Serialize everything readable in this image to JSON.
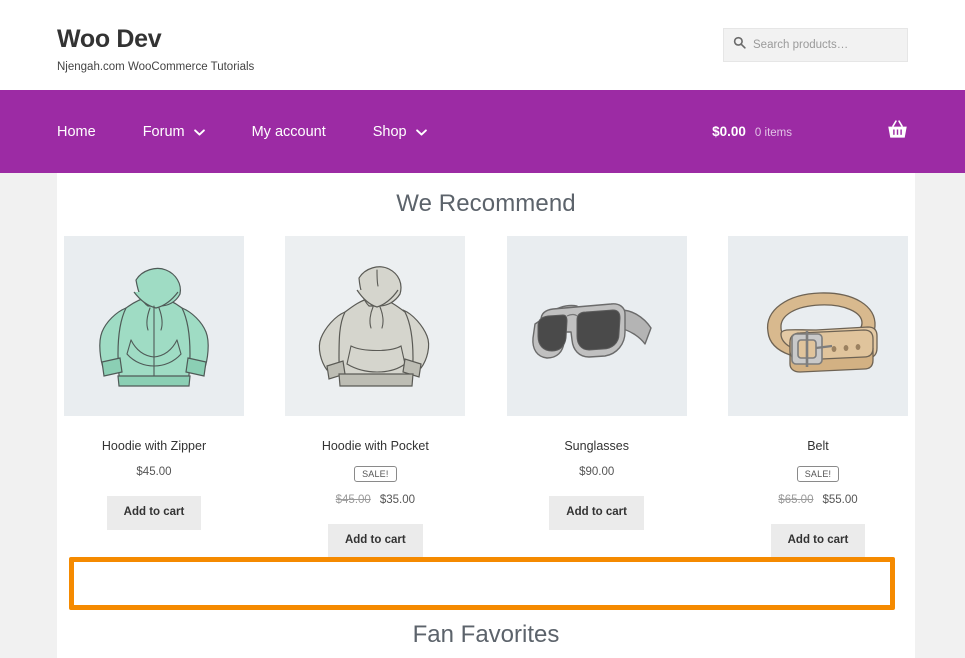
{
  "header": {
    "site_title": "Woo Dev",
    "tagline": "Njengah.com WooCommerce Tutorials",
    "search": {
      "placeholder": "Search products…",
      "value": "",
      "icon": "search-icon"
    }
  },
  "nav": {
    "background_color": "#9c2ba4",
    "items": [
      {
        "label": "Home",
        "has_dropdown": false
      },
      {
        "label": "Forum",
        "has_dropdown": true
      },
      {
        "label": "My account",
        "has_dropdown": false
      },
      {
        "label": "Shop",
        "has_dropdown": true
      }
    ],
    "cart": {
      "total": "$0.00",
      "items_text": "0 items",
      "icon": "shopping-basket-icon"
    }
  },
  "main": {
    "section_title": "We Recommend",
    "bottom_section_title": "Fan Favorites",
    "products": [
      {
        "name": "Hoodie with Zipper",
        "image": "mint-green-zip-hoodie",
        "on_sale": false,
        "sale_label": "",
        "price": "$45.00",
        "old_price": "",
        "button_label": "Add to cart"
      },
      {
        "name": "Hoodie with Pocket",
        "image": "gray-pullover-hoodie",
        "on_sale": true,
        "sale_label": "SALE!",
        "price": "$35.00",
        "old_price": "$45.00",
        "button_label": "Add to cart"
      },
      {
        "name": "Sunglasses",
        "image": "gray-sunglasses",
        "on_sale": false,
        "sale_label": "",
        "price": "$90.00",
        "old_price": "",
        "button_label": "Add to cart"
      },
      {
        "name": "Belt",
        "image": "tan-leather-belt",
        "on_sale": true,
        "sale_label": "SALE!",
        "price": "$55.00",
        "old_price": "$65.00",
        "button_label": "Add to cart"
      }
    ],
    "highlight": {
      "color": "#f58a00",
      "content": ""
    }
  },
  "colors": {
    "nav_purple": "#9c2ba4",
    "page_background": "#f1f1f1",
    "content_background": "#ffffff",
    "thumb_background": "#e9edf0",
    "button_background": "#ebebeb",
    "highlight_orange": "#f58a00",
    "heading_text": "#5c636b"
  }
}
